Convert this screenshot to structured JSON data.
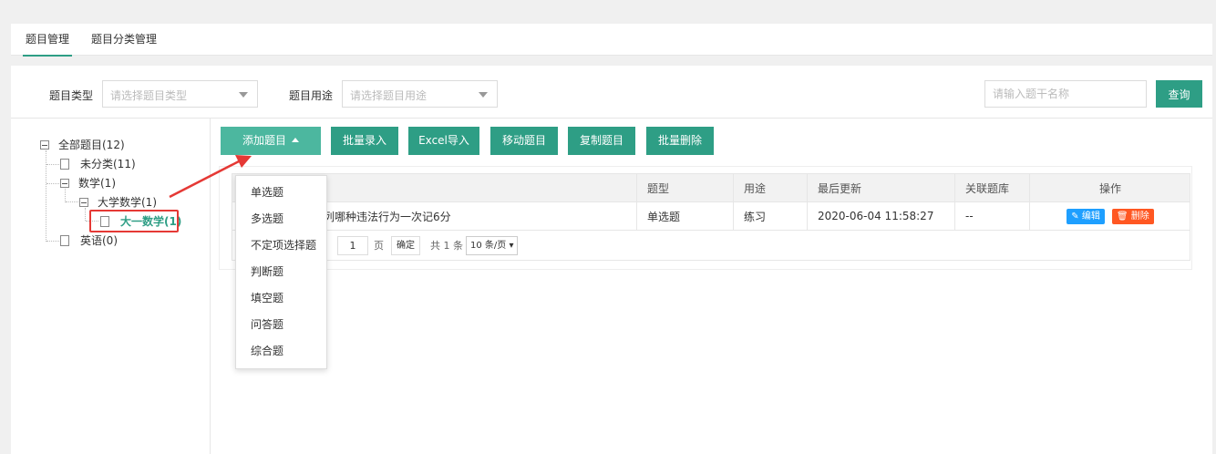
{
  "tabs": [
    {
      "label": "题目管理",
      "active": true
    },
    {
      "label": "题目分类管理",
      "active": false
    }
  ],
  "filters": {
    "type_label": "题目类型",
    "type_placeholder": "请选择题目类型",
    "usage_label": "题目用途",
    "usage_placeholder": "请选择题目用途",
    "search_placeholder": "请输入题干名称",
    "query_label": "查询"
  },
  "tree": {
    "root": "全部题目(12)",
    "uncategorized": "未分类(11)",
    "math": "数学(1)",
    "college_math": "大学数学(1)",
    "freshman_math": "大一数学(1)",
    "english": "英语(0)"
  },
  "toolbar": {
    "add": "添加题目",
    "batch_entry": "批量录入",
    "excel_import": "Excel导入",
    "move": "移动题目",
    "copy": "复制题目",
    "batch_delete": "批量删除"
  },
  "table": {
    "headers": [
      "题型",
      "用途",
      "最后更新",
      "关联题库",
      "操作"
    ],
    "rows": [
      {
        "stem": "下列哪种违法行为一次记6分",
        "type": "单选题",
        "usage": "练习",
        "updated": "2020-06-04 11:58:27",
        "bank": "--"
      }
    ],
    "edit_label": "编辑",
    "delete_label": "删除"
  },
  "pager": {
    "page_value": "1",
    "page_unit": "页",
    "confirm": "确定",
    "total": "共 1 条",
    "page_size": "10 条/页"
  },
  "dropdown": {
    "items": [
      "单选题",
      "多选题",
      "不定项选择题",
      "判断题",
      "填空题",
      "问答题",
      "综合题"
    ]
  },
  "colors": {
    "accent": "#2e9e85",
    "highlight": "#e53935",
    "edit": "#1e9fff",
    "delete": "#ff5722"
  }
}
